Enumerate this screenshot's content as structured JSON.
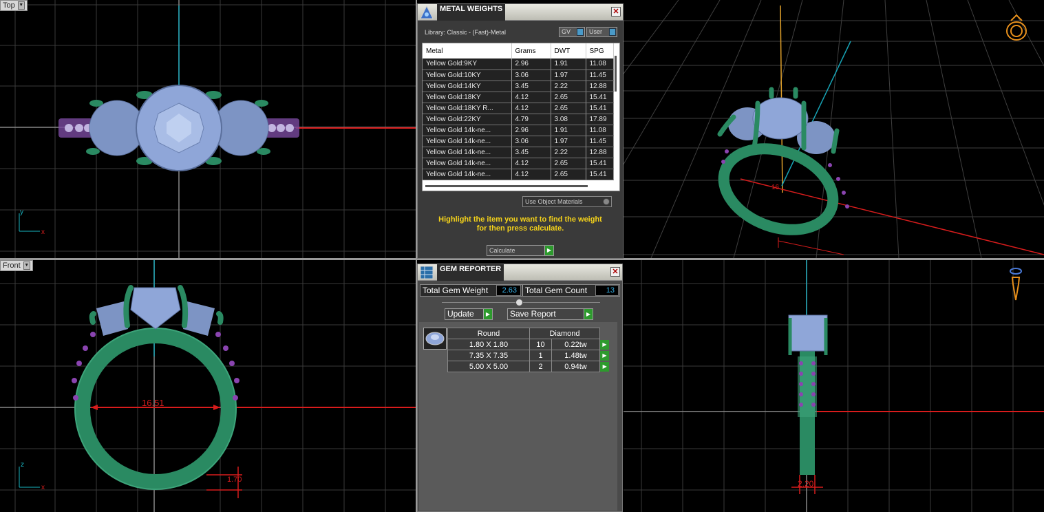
{
  "viewports": {
    "top": {
      "label": "Top",
      "axis_v": "y",
      "axis_h": "x"
    },
    "front": {
      "label": "Front",
      "axis_v": "z",
      "axis_h": "x",
      "dim_width": "16.51",
      "dim_height": "1.70"
    },
    "side": {
      "dim_width": "2.20"
    }
  },
  "metal_weights": {
    "title": "METAL WEIGHTS",
    "library": "Library: Classic - (Fast)-Metal",
    "toggle_gv": "GV",
    "toggle_user": "User",
    "columns": [
      "Metal",
      "Grams",
      "DWT",
      "SPG"
    ],
    "rows": [
      [
        "Yellow Gold:9KY",
        "2.96",
        "1.91",
        "11.08"
      ],
      [
        "Yellow Gold:10KY",
        "3.06",
        "1.97",
        "11.45"
      ],
      [
        "Yellow Gold:14KY",
        "3.45",
        "2.22",
        "12.88"
      ],
      [
        "Yellow Gold:18KY",
        "4.12",
        "2.65",
        "15.41"
      ],
      [
        "Yellow Gold:18KY R...",
        "4.12",
        "2.65",
        "15.41"
      ],
      [
        "Yellow Gold:22KY",
        "4.79",
        "3.08",
        "17.89"
      ],
      [
        "Yellow Gold 14k-ne...",
        "2.96",
        "1.91",
        "11.08"
      ],
      [
        "Yellow Gold 14k-ne...",
        "3.06",
        "1.97",
        "11.45"
      ],
      [
        "Yellow Gold 14k-ne...",
        "3.45",
        "2.22",
        "12.88"
      ],
      [
        "Yellow Gold 14k-ne...",
        "4.12",
        "2.65",
        "15.41"
      ],
      [
        "Yellow Gold 14k-ne...",
        "4.12",
        "2.65",
        "15.41"
      ]
    ],
    "use_object_materials": "Use Object Materials",
    "hint_line1": "Highlight the item you want to find the weight",
    "hint_line2": "for then press calculate.",
    "calculate": "Calculate"
  },
  "gem_reporter": {
    "title": "GEM REPORTER",
    "total_weight_label": "Total Gem Weight",
    "total_weight_value": "2.63",
    "total_count_label": "Total Gem Count",
    "total_count_value": "13",
    "update": "Update",
    "save_report": "Save Report",
    "col_shape": "Round",
    "col_material": "Diamond",
    "rows": [
      {
        "size": "1.80 X 1.80",
        "count": "10",
        "weight": "0.22tw"
      },
      {
        "size": "7.35 X 7.35",
        "count": "1",
        "weight": "1.48tw"
      },
      {
        "size": "5.00 X 5.00",
        "count": "2",
        "weight": "0.94tw"
      }
    ]
  },
  "colors": {
    "metal": "#2a8a62",
    "stone": "#8fa6d8",
    "accent_stone": "#8a44b0",
    "dim": "#d81c1c",
    "highlight": "#f4d21a"
  }
}
